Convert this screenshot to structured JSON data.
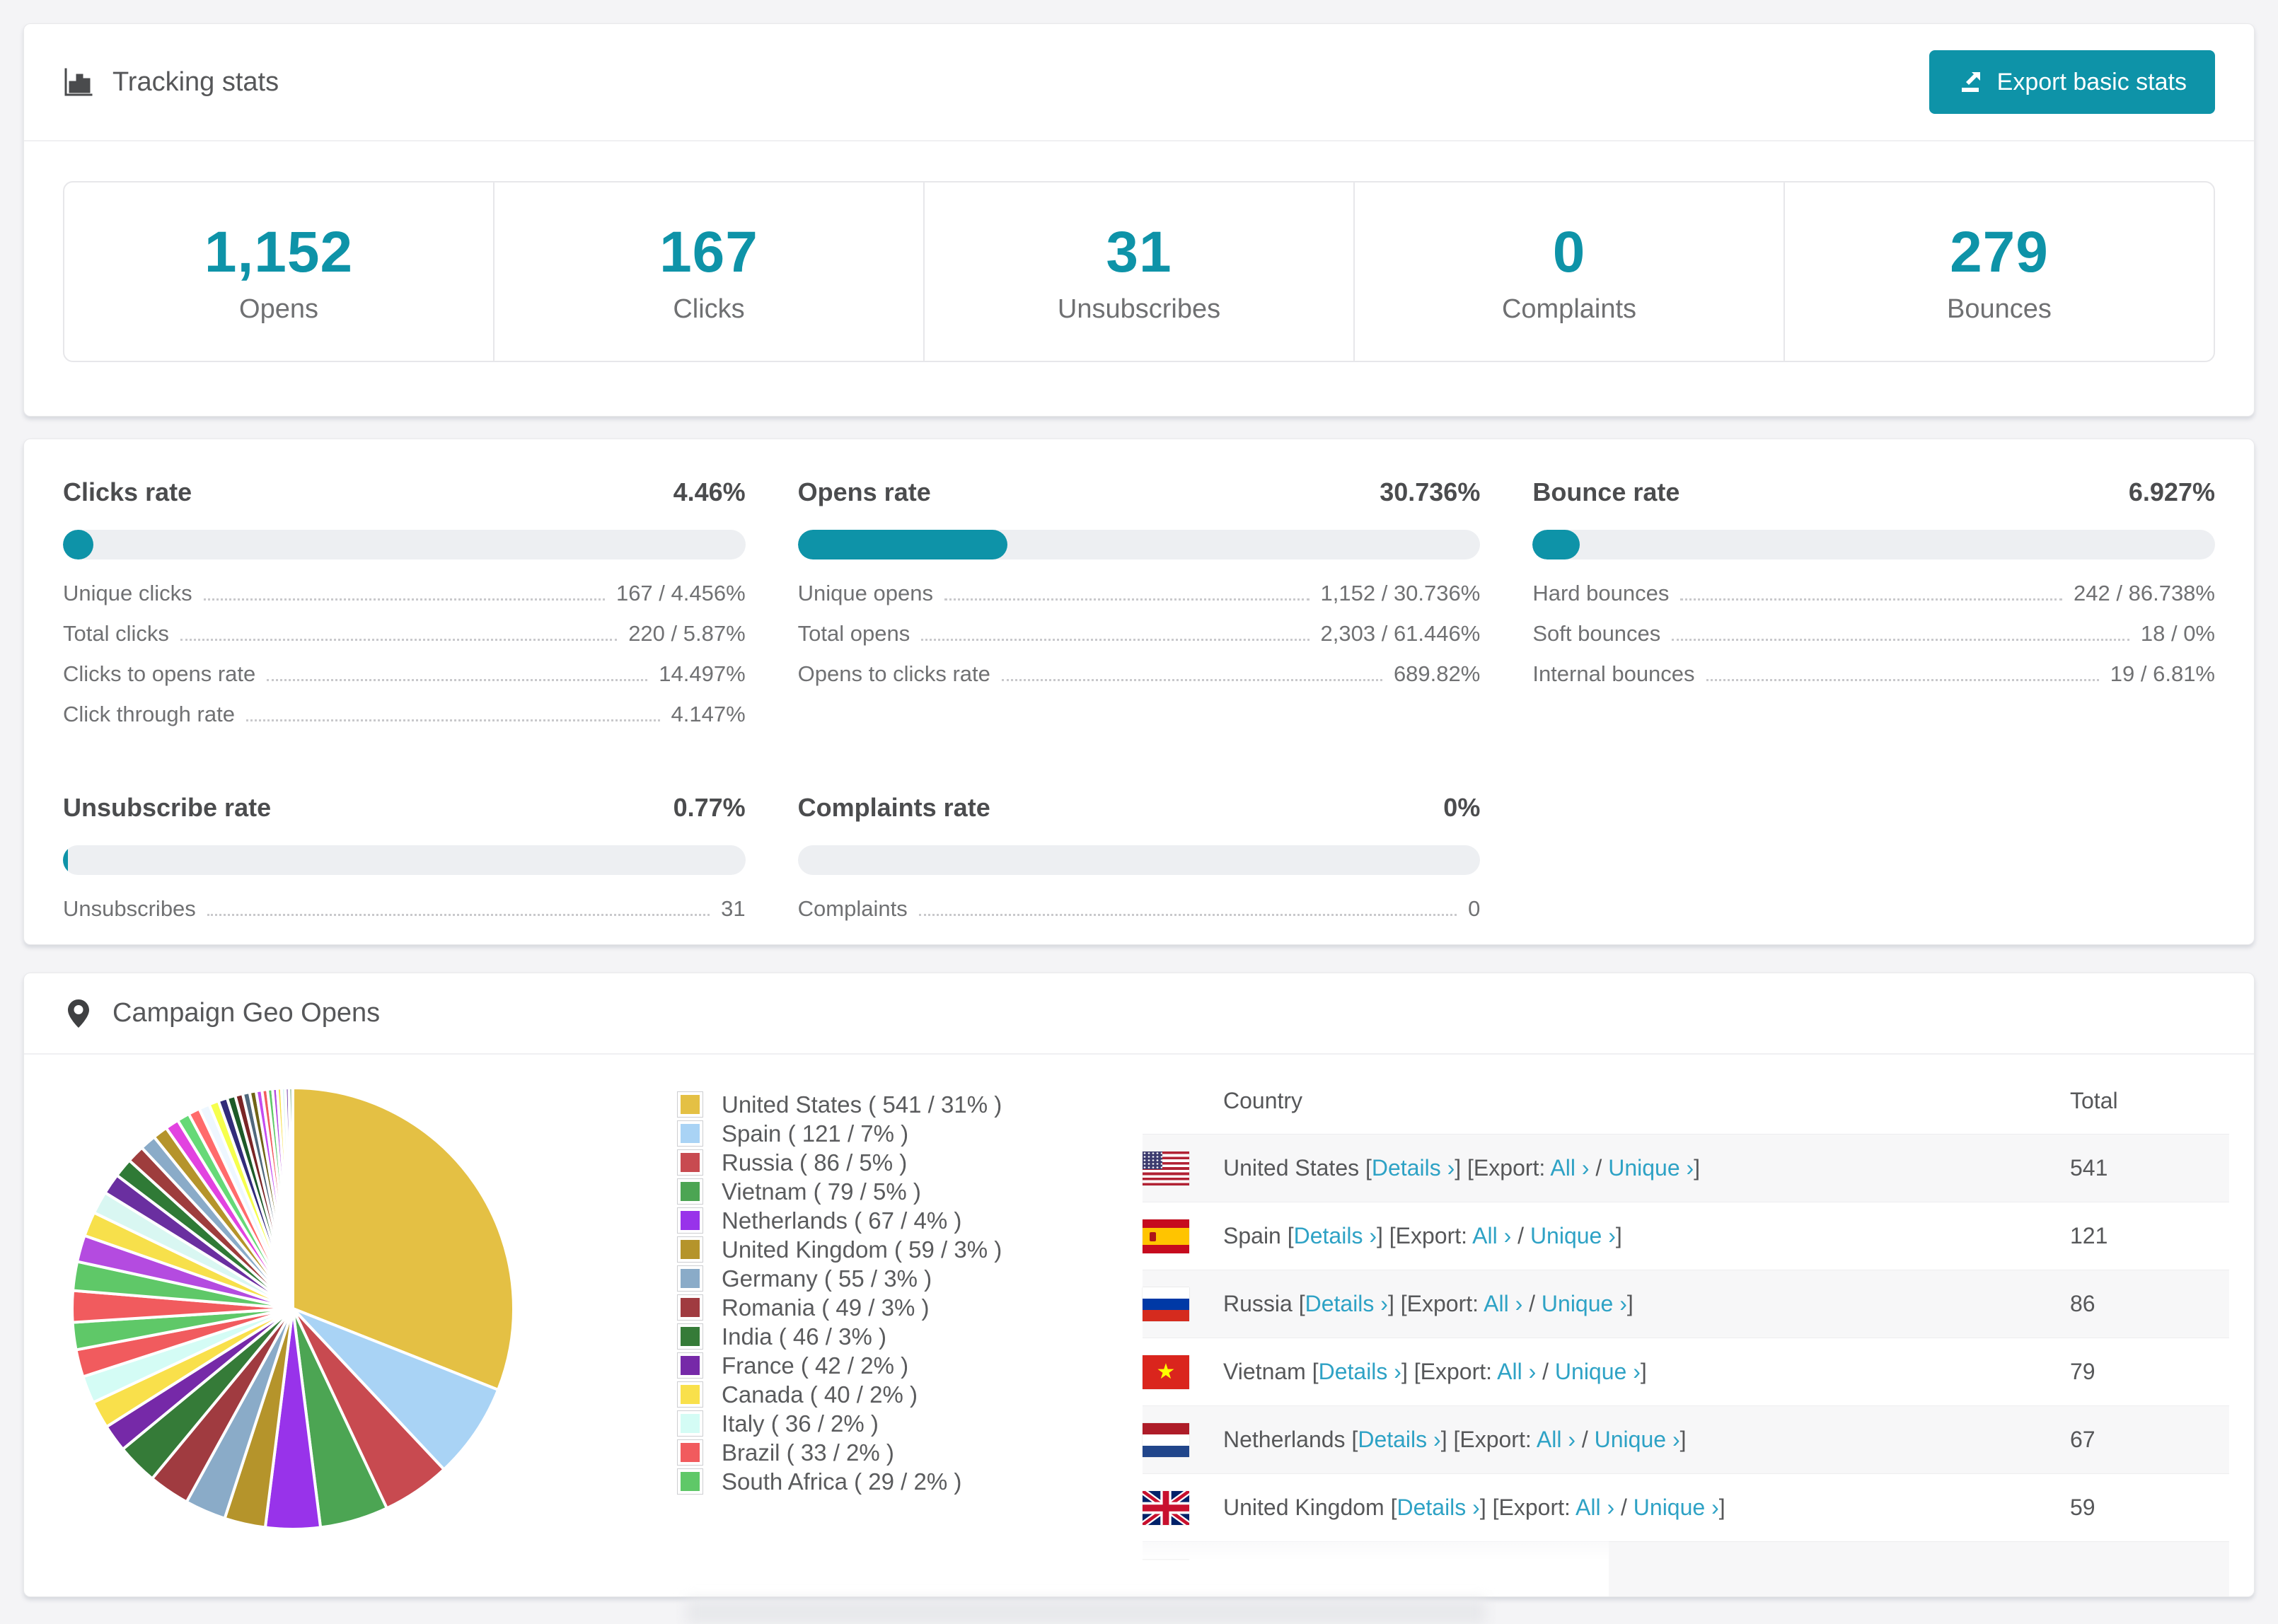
{
  "accent_color": "#0e93a8",
  "link_color": "#2ea2c5",
  "tracking_card": {
    "title": "Tracking stats",
    "export_button_label": "Export basic stats",
    "stats": [
      {
        "value": "1,152",
        "label": "Opens"
      },
      {
        "value": "167",
        "label": "Clicks"
      },
      {
        "value": "31",
        "label": "Unsubscribes"
      },
      {
        "value": "0",
        "label": "Complaints"
      },
      {
        "value": "279",
        "label": "Bounces"
      }
    ]
  },
  "rates": [
    {
      "title": "Clicks rate",
      "value": "4.46%",
      "percent": 4.46,
      "rows": [
        {
          "label": "Unique clicks",
          "value": "167 / 4.456%"
        },
        {
          "label": "Total clicks",
          "value": "220 / 5.87%"
        },
        {
          "label": "Clicks to opens rate",
          "value": "14.497%"
        },
        {
          "label": "Click through rate",
          "value": "4.147%"
        }
      ]
    },
    {
      "title": "Opens rate",
      "value": "30.736%",
      "percent": 30.736,
      "rows": [
        {
          "label": "Unique opens",
          "value": "1,152 / 30.736%"
        },
        {
          "label": "Total opens",
          "value": "2,303 / 61.446%"
        },
        {
          "label": "Opens to clicks rate",
          "value": "689.82%"
        }
      ]
    },
    {
      "title": "Bounce rate",
      "value": "6.927%",
      "percent": 6.927,
      "rows": [
        {
          "label": "Hard bounces",
          "value": "242 / 86.738%"
        },
        {
          "label": "Soft bounces",
          "value": "18 / 0%"
        },
        {
          "label": "Internal bounces",
          "value": "19 / 6.81%"
        }
      ]
    },
    {
      "title": "Unsubscribe rate",
      "value": "0.77%",
      "percent": 0.77,
      "rows": [
        {
          "label": "Unsubscribes",
          "value": "31"
        }
      ]
    },
    {
      "title": "Complaints rate",
      "value": "0%",
      "percent": 0,
      "rows": [
        {
          "label": "Complaints",
          "value": "0"
        }
      ]
    }
  ],
  "chart_data": {
    "type": "pie",
    "title": "Campaign Geo Opens",
    "legend_position": "right",
    "slices": [
      {
        "label": "United States",
        "value": 541,
        "percent": 31,
        "color": "#e4c044"
      },
      {
        "label": "Spain",
        "value": 121,
        "percent": 7,
        "color": "#a9d3f5"
      },
      {
        "label": "Russia",
        "value": 86,
        "percent": 5,
        "color": "#c84a50"
      },
      {
        "label": "Vietnam",
        "value": 79,
        "percent": 5,
        "color": "#4ca553"
      },
      {
        "label": "Netherlands",
        "value": 67,
        "percent": 4,
        "color": "#9833ea"
      },
      {
        "label": "United Kingdom",
        "value": 59,
        "percent": 3,
        "color": "#b5942b"
      },
      {
        "label": "Germany",
        "value": 55,
        "percent": 3,
        "color": "#8aabc8"
      },
      {
        "label": "Romania",
        "value": 49,
        "percent": 3,
        "color": "#a03b40"
      },
      {
        "label": "India",
        "value": 46,
        "percent": 3,
        "color": "#357b38"
      },
      {
        "label": "France",
        "value": 42,
        "percent": 2,
        "color": "#7629a8"
      },
      {
        "label": "Canada",
        "value": 40,
        "percent": 2,
        "color": "#f9e04b"
      },
      {
        "label": "Italy",
        "value": 36,
        "percent": 2,
        "color": "#d4fcf5"
      },
      {
        "label": "Brazil",
        "value": 33,
        "percent": 2,
        "color": "#f15b5e"
      },
      {
        "label": "South Africa",
        "value": 29,
        "percent": 2,
        "color": "#5fc868"
      }
    ],
    "others_percent": 26,
    "others_palette": [
      "#f15b5e",
      "#5fc868",
      "#b44be0",
      "#f7e04b",
      "#d9f7f2",
      "#6a2fa0",
      "#2f7a36",
      "#9e3d3d",
      "#8aabc8",
      "#b5942b",
      "#e243e0",
      "#66d977",
      "#ff6b6b",
      "#eef7ff",
      "#f6ff4d",
      "#322b7a",
      "#1d5a28",
      "#7a2525",
      "#50687c",
      "#6f6316",
      "#c44bf0"
    ]
  },
  "geo_card": {
    "title": "Campaign Geo Opens",
    "legend_format": "{label} ( {value} / {percent}% )",
    "table": {
      "columns": [
        "Country",
        "Total"
      ],
      "details_label": "Details ›",
      "all_label": "All ›",
      "unique_label": "Unique ›",
      "bracket_open": " [",
      "export_open": " [Export: ",
      "slash": " / ",
      "bracket_close": "]",
      "rows": [
        {
          "country": "United States",
          "flag": "us",
          "total": "541"
        },
        {
          "country": "Spain",
          "flag": "es",
          "total": "121"
        },
        {
          "country": "Russia",
          "flag": "ru",
          "total": "86"
        },
        {
          "country": "Vietnam",
          "flag": "vn",
          "total": "79"
        },
        {
          "country": "Netherlands",
          "flag": "nl",
          "total": "67"
        },
        {
          "country": "United Kingdom",
          "flag": "gb",
          "total": "59"
        },
        {
          "country": "",
          "flag": "de",
          "total": ""
        }
      ]
    }
  }
}
